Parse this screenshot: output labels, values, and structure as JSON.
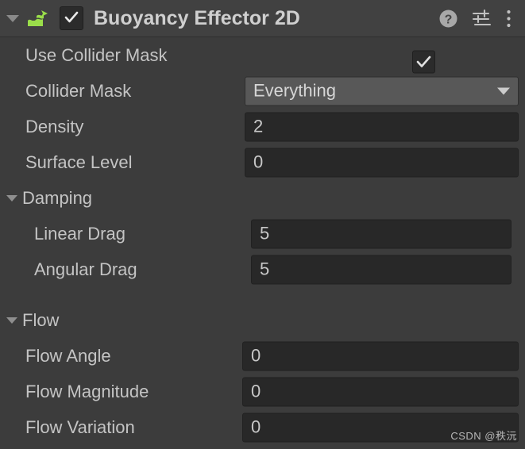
{
  "component": {
    "title": "Buoyancy Effector 2D",
    "enabled": true,
    "expanded": true,
    "icon_name": "buoyancy-effector-2d-icon",
    "icon_color": "#9ade4a",
    "header_bg": "#414141",
    "body_bg": "#3c3c3c",
    "header_icons": [
      {
        "name": "help-icon",
        "glyph": "?"
      },
      {
        "name": "preset-settings-icon",
        "glyph": "sliders"
      },
      {
        "name": "more-options-icon",
        "glyph": "kebab"
      }
    ]
  },
  "properties": [
    {
      "label": "Use Collider Mask",
      "control": "checkbox",
      "value": "true",
      "indent": 1,
      "name": "use-collider-mask"
    },
    {
      "label": "Collider Mask",
      "control": "dropdown",
      "value": "Everything",
      "indent": 1,
      "name": "collider-mask"
    },
    {
      "label": "Density",
      "control": "number",
      "value": "2",
      "indent": 1,
      "name": "density"
    },
    {
      "label": "Surface Level",
      "control": "number",
      "value": "0",
      "indent": 1,
      "name": "surface-level"
    },
    {
      "label": "Damping",
      "control": "foldout",
      "value": "",
      "expanded": true,
      "indent": 0,
      "name": "damping-foldout"
    },
    {
      "label": "Linear Drag",
      "control": "number",
      "value": "5",
      "indent": 2,
      "name": "linear-drag"
    },
    {
      "label": "Angular Drag",
      "control": "number",
      "value": "5",
      "indent": 2,
      "name": "angular-drag"
    },
    {
      "label": "Flow",
      "control": "foldout",
      "value": "",
      "expanded": true,
      "indent": 0,
      "name": "flow-foldout"
    },
    {
      "label": "Flow Angle",
      "control": "number",
      "value": "0",
      "indent": 1,
      "name": "flow-angle"
    },
    {
      "label": "Flow Magnitude",
      "control": "number",
      "value": "0",
      "indent": 1,
      "name": "flow-magnitude"
    },
    {
      "label": "Flow Variation",
      "control": "number",
      "value": "0",
      "indent": 1,
      "name": "flow-variation"
    }
  ],
  "watermark": "CSDN @秩沅"
}
